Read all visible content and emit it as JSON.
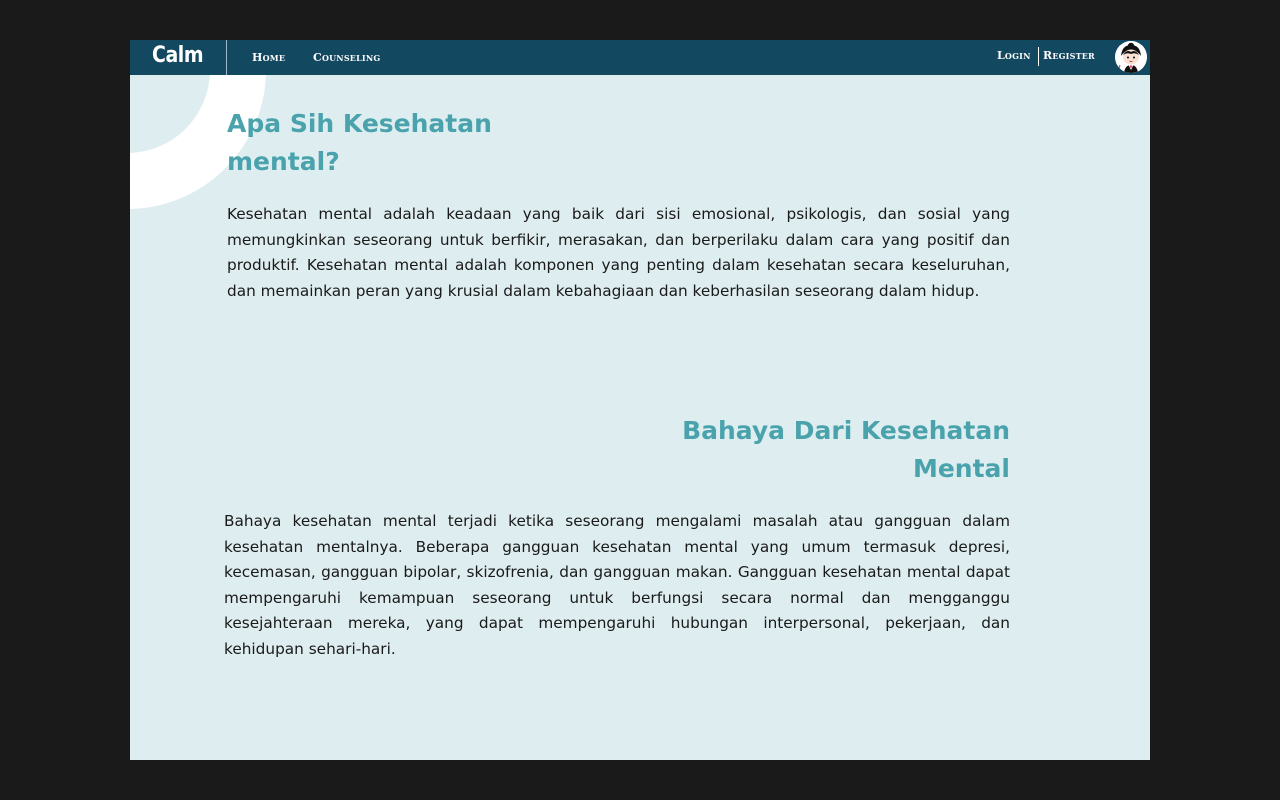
{
  "nav": {
    "brand": "Calm",
    "links": [
      "Home",
      "Counseling"
    ],
    "login_label": "Login",
    "register_label": "Register"
  },
  "sections": [
    {
      "title_line1": "Apa Sih Kesehatan",
      "title_line2": "mental?",
      "body": "Kesehatan mental adalah keadaan yang baik dari sisi emosional, psikologis, dan sosial yang memungkinkan seseorang untuk berfikir, merasakan, dan berperilaku dalam cara yang positif dan produktif. Kesehatan mental adalah komponen yang penting dalam kesehatan secara keseluruhan, dan memainkan peran yang krusial dalam kebahagiaan dan keberhasilan seseorang dalam hidup."
    },
    {
      "title_line1": "Bahaya Dari Kesehatan",
      "title_line2": "Mental",
      "body": "Bahaya kesehatan mental terjadi ketika seseorang mengalami masalah atau gangguan dalam kesehatan mentalnya. Beberapa gangguan kesehatan mental yang umum termasuk depresi, kecemasan, gangguan bipolar, skizofrenia, dan gangguan makan. Gangguan kesehatan mental dapat mempengaruhi kemampuan seseorang untuk berfungsi secara normal dan mengganggu kesejahteraan mereka, yang dapat mempengaruhi hubungan interpersonal, pekerjaan, dan kehidupan sehari-hari."
    }
  ],
  "colors": {
    "navbar": "#134861",
    "page_background": "#deedf0",
    "heading": "#4aa3ac",
    "body_text": "#1a1a1a"
  },
  "icons": {
    "avatar": "user-avatar-icon"
  }
}
